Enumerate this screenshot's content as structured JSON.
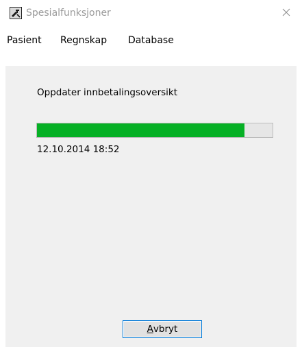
{
  "window": {
    "title": "Spesialfunksjoner",
    "icon": "app-tools-icon",
    "close_icon": "close-icon"
  },
  "menu": {
    "items": [
      {
        "label": "Pasient"
      },
      {
        "label": "Regnskap"
      },
      {
        "label": "Database"
      }
    ]
  },
  "task": {
    "label": "Oppdater innbetalingsoversikt",
    "progress_percent": 88,
    "timestamp": "12.10.2014 18:52"
  },
  "cancel_button": {
    "mnemonic": "A",
    "rest": "vbryt"
  },
  "colors": {
    "progress_fill": "#06b025",
    "progress_track": "#e6e6e6",
    "panel_bg": "#f0f0f0",
    "button_border": "#0078d7"
  }
}
